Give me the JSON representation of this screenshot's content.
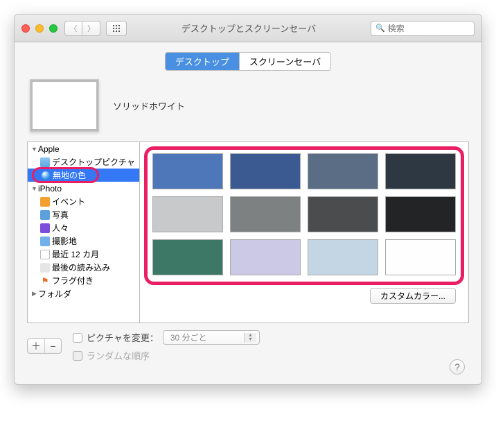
{
  "window": {
    "title": "デスクトップとスクリーンセーバ"
  },
  "search": {
    "placeholder": "検索"
  },
  "tabs": {
    "desktop": "デスクトップ",
    "screensaver": "スクリーンセーバ"
  },
  "preview": {
    "label": "ソリッドホワイト"
  },
  "sidebar": {
    "apple": "Apple",
    "desktop_pictures": "デスクトップピクチャ",
    "solid_colors": "無地の色",
    "iphoto": "iPhoto",
    "events": "イベント",
    "photos": "写真",
    "people": "人々",
    "places": "撮影地",
    "recent12": "最近 12 カ月",
    "last_import": "最後の読み込み",
    "flagged": "フラグ付き",
    "folders": "フォルダ"
  },
  "swatches": [
    "#4e77b9",
    "#3a5a91",
    "#5a6d85",
    "#2d3842",
    "#c7c9cb",
    "#7e8182",
    "#4a4c4e",
    "#232425",
    "#3d7866",
    "#ccc9e6",
    "#c4d5e4",
    "#fefefe"
  ],
  "custom_color": "カスタムカラー...",
  "footer": {
    "change_picture": "ピクチャを変更：",
    "interval": "30 分ごと",
    "random": "ランダムな順序"
  }
}
